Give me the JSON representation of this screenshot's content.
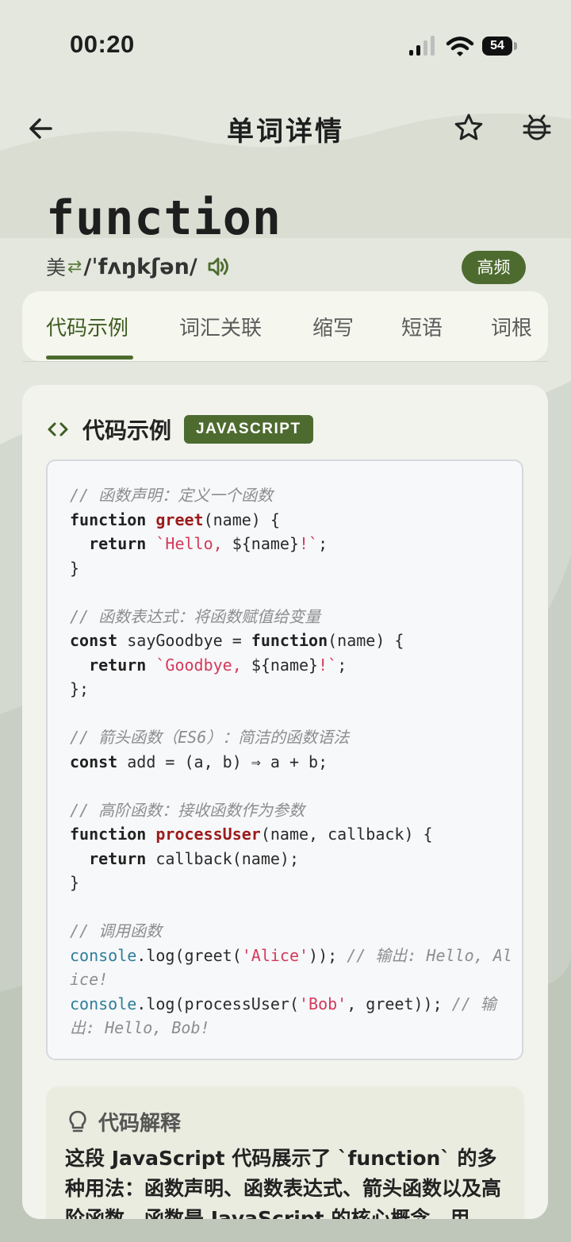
{
  "status_bar": {
    "time": "00:20",
    "battery": "54"
  },
  "nav": {
    "title": "单词详情"
  },
  "word": {
    "text": "function",
    "region": "美",
    "phonetic": "/ˈfʌŋkʃən/",
    "frequency_badge": "高频"
  },
  "tabs": [
    "代码示例",
    "词汇关联",
    "缩写",
    "短语",
    "词根"
  ],
  "active_tab": 0,
  "code_section": {
    "title": "代码示例",
    "language": "JAVASCRIPT",
    "lines": [
      [
        [
          "c",
          "// 函数声明：定义一个函数"
        ]
      ],
      [
        [
          "k",
          "function "
        ],
        [
          "f",
          "greet"
        ],
        [
          "p",
          "(name) {"
        ]
      ],
      [
        [
          "p",
          "  "
        ],
        [
          "k",
          "return "
        ],
        [
          "s",
          "`Hello, "
        ],
        [
          "p",
          "${name}"
        ],
        [
          "s",
          "!`"
        ],
        [
          "p",
          ";"
        ]
      ],
      [
        [
          "p",
          "}"
        ]
      ],
      [
        [
          "p",
          ""
        ]
      ],
      [
        [
          "c",
          "// 函数表达式：将函数赋值给变量"
        ]
      ],
      [
        [
          "k",
          "const "
        ],
        [
          "p",
          "sayGoodbye = "
        ],
        [
          "k",
          "function"
        ],
        [
          "p",
          "(name) {"
        ]
      ],
      [
        [
          "p",
          "  "
        ],
        [
          "k",
          "return "
        ],
        [
          "s",
          "`Goodbye, "
        ],
        [
          "p",
          "${name}"
        ],
        [
          "s",
          "!`"
        ],
        [
          "p",
          ";"
        ]
      ],
      [
        [
          "p",
          "};"
        ]
      ],
      [
        [
          "p",
          ""
        ]
      ],
      [
        [
          "c",
          "// 箭头函数（ES6）：简洁的函数语法"
        ]
      ],
      [
        [
          "k",
          "const "
        ],
        [
          "p",
          "add = (a, b) ⇒ a + b;"
        ]
      ],
      [
        [
          "p",
          ""
        ]
      ],
      [
        [
          "c",
          "// 高阶函数：接收函数作为参数"
        ]
      ],
      [
        [
          "k",
          "function "
        ],
        [
          "f",
          "processUser"
        ],
        [
          "p",
          "(name, callback) {"
        ]
      ],
      [
        [
          "p",
          "  "
        ],
        [
          "k",
          "return "
        ],
        [
          "p",
          "callback(name);"
        ]
      ],
      [
        [
          "p",
          "}"
        ]
      ],
      [
        [
          "p",
          ""
        ]
      ],
      [
        [
          "c",
          "// 调用函数"
        ]
      ],
      [
        [
          "b",
          "console"
        ],
        [
          "p",
          ".log(greet("
        ],
        [
          "s",
          "'Alice'"
        ],
        [
          "p",
          ")); "
        ],
        [
          "c",
          "// 输出: Hello, Alice!"
        ]
      ],
      [
        [
          "b",
          "console"
        ],
        [
          "p",
          ".log(processUser("
        ],
        [
          "s",
          "'Bob'"
        ],
        [
          "p",
          ", greet)); "
        ],
        [
          "c",
          "// 输出: Hello, Bob!"
        ]
      ]
    ]
  },
  "explanation": {
    "title": "代码解释",
    "text": "这段 JavaScript 代码展示了 `function` 的多种用法：函数声明、函数表达式、箭头函数以及高阶函数。函数是 JavaScript 的核心概念，用"
  },
  "icons": {
    "back": "arrow-left-icon",
    "favorite": "star-icon",
    "debug": "bug-icon",
    "speaker": "speaker-icon",
    "code": "code-brackets-icon",
    "hint": "lightbulb-icon"
  },
  "colors": {
    "accent": "#4d6b2f",
    "background": "#e2e6dc",
    "string": "#d43a5a",
    "function_name": "#9b1b1b",
    "builtin": "#2e7d9a",
    "comment": "#8d8d8d"
  }
}
